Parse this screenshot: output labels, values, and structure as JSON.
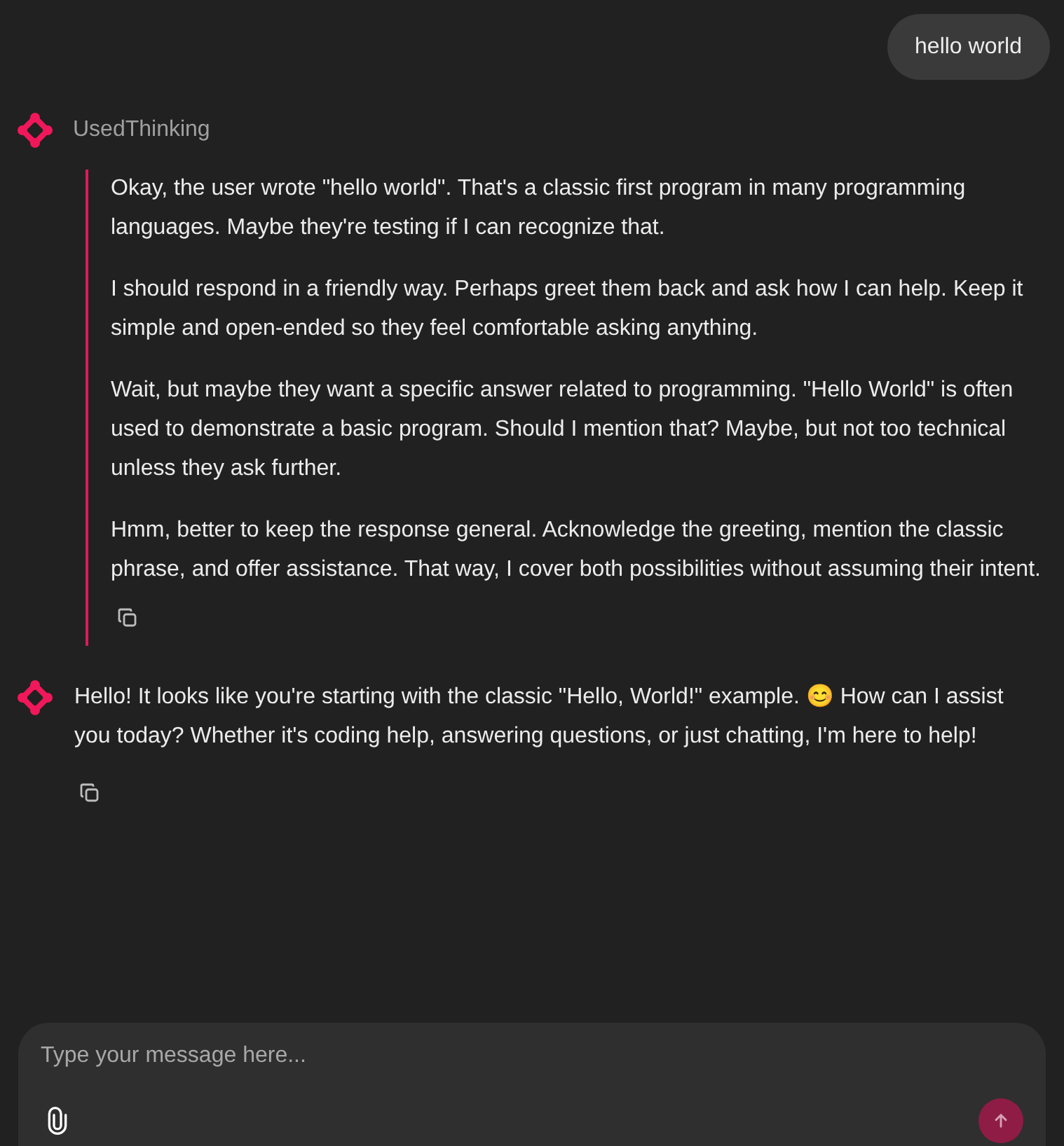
{
  "user_message": {
    "text": "hello world"
  },
  "thinking": {
    "author": "UsedThinking",
    "paragraphs": [
      "Okay, the user wrote \"hello world\". That's a classic first program in many programming languages. Maybe they're testing if I can recognize that.",
      "I should respond in a friendly way. Perhaps greet them back and ask how I can help. Keep it simple and open-ended so they feel comfortable asking anything.",
      "Wait, but maybe they want a specific answer related to programming. \"Hello World\" is often used to demonstrate a basic program. Should I mention that? Maybe, but not too technical unless they ask further.",
      "Hmm, better to keep the response general. Acknowledge the greeting, mention the classic phrase, and offer assistance. That way, I cover both possibilities without assuming their intent."
    ]
  },
  "reply": {
    "text": "Hello! It looks like you're starting with the classic \"Hello, World!\" example. 😊 How can I assist you today? Whether it's coding help, answering questions, or just chatting, I'm here to help!"
  },
  "composer": {
    "placeholder": "Type your message here...",
    "send_disabled": true
  }
}
